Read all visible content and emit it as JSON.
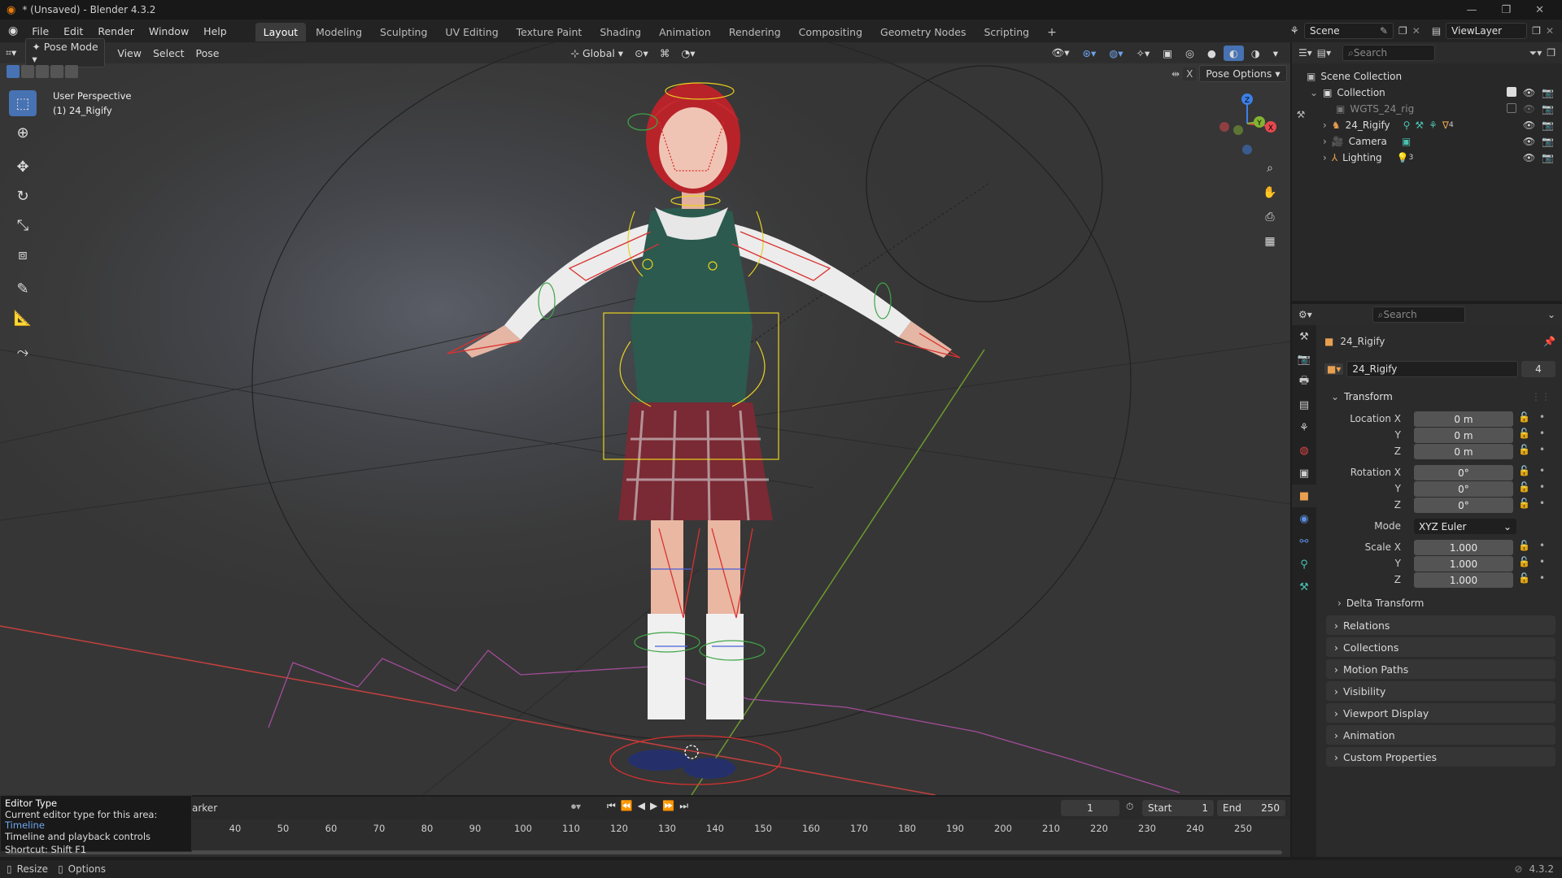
{
  "window": {
    "title": "* (Unsaved) - Blender 4.3.2"
  },
  "menus": [
    "File",
    "Edit",
    "Render",
    "Window",
    "Help"
  ],
  "workspaces": [
    "Layout",
    "Modeling",
    "Sculpting",
    "UV Editing",
    "Texture Paint",
    "Shading",
    "Animation",
    "Rendering",
    "Compositing",
    "Geometry Nodes",
    "Scripting"
  ],
  "active_workspace": "Layout",
  "scene": {
    "label": "Scene",
    "view_layer": "ViewLayer"
  },
  "viewport": {
    "mode": "Pose Mode",
    "menus": [
      "View",
      "Select",
      "Pose"
    ],
    "orientation": "Global",
    "overlay_text_1": "User Perspective",
    "overlay_text_2": "(1) 24_Rigify",
    "pose_options": "Pose Options",
    "gizmo_axes": {
      "x": "X",
      "y": "Y",
      "z": "Z"
    }
  },
  "outliner": {
    "search_placeholder": "Search",
    "items": [
      {
        "label": "Scene Collection"
      },
      {
        "label": "Collection"
      },
      {
        "label": "WGTS_24_rig"
      },
      {
        "label": "24_Rigify",
        "badge": "4"
      },
      {
        "label": "Camera"
      },
      {
        "label": "Lighting",
        "badge": "3"
      }
    ]
  },
  "properties": {
    "search_placeholder": "Search",
    "object_name": "24_Rigify",
    "datablock_name": "24_Rigify",
    "users": "4",
    "transform_header": "Transform",
    "location": {
      "label": "Location X",
      "x": "0 m",
      "y": "0 m",
      "z": "0 m"
    },
    "rotation": {
      "label": "Rotation X",
      "x": "0°",
      "y": "0°",
      "z": "0°"
    },
    "mode": {
      "label": "Mode",
      "value": "XYZ Euler"
    },
    "scale": {
      "label": "Scale X",
      "x": "1.000",
      "y": "1.000",
      "z": "1.000"
    },
    "axis_y": "Y",
    "axis_z": "Z",
    "delta_transform": "Delta Transform",
    "panels": [
      "Relations",
      "Collections",
      "Motion Paths",
      "Visibility",
      "Viewport Display",
      "Animation",
      "Custom Properties"
    ]
  },
  "timeline": {
    "marker_label": "arker",
    "current_frame": "1",
    "start_label": "Start",
    "start": "1",
    "end_label": "End",
    "end": "250",
    "ticks": [
      "40",
      "50",
      "60",
      "70",
      "80",
      "90",
      "100",
      "110",
      "120",
      "130",
      "140",
      "150",
      "160",
      "170",
      "180",
      "190",
      "200",
      "210",
      "220",
      "230",
      "240",
      "250"
    ]
  },
  "tooltip": {
    "title": "Editor Type",
    "line1_prefix": "Current editor type for this area: ",
    "line1_value": "Timeline",
    "line2": "Timeline and playback controls",
    "line3": "Shortcut: Shift F1"
  },
  "statusbar": {
    "left1": "Resize",
    "left2": "Options",
    "version": "4.3.2"
  },
  "colors": {
    "accent": "#4772b3",
    "x_axis": "#e5484d",
    "y_axis": "#82b332",
    "z_axis": "#3d7fe6",
    "rig_yellow": "#e8d21f",
    "rig_red": "#d8322f"
  }
}
